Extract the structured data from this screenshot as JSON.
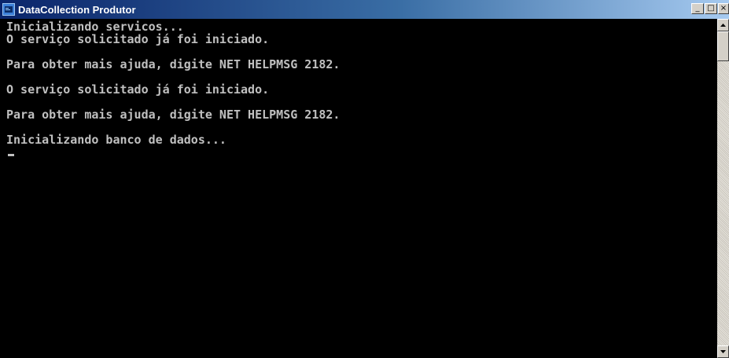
{
  "window": {
    "title": "DataCollection Produtor",
    "icon": "console-app-icon",
    "controls": {
      "minimize": "_",
      "maximize": "□",
      "close": "×"
    }
  },
  "console": {
    "lines": [
      "Inicializando servicos...",
      "O serviço solicitado já foi iniciado.",
      "Para obter mais ajuda, digite NET HELPMSG 2182.",
      "O serviço solicitado já foi iniciado.",
      "Para obter mais ajuda, digite NET HELPMSG 2182.",
      "Inicializando banco de dados..."
    ],
    "text_color": "#c0c0c0",
    "background": "#000000"
  },
  "scrollbar": {
    "up_icon": "arrow-up-icon",
    "down_icon": "arrow-down-icon"
  },
  "colors": {
    "titlebar_start": "#0a246a",
    "titlebar_end": "#a6caf0"
  }
}
